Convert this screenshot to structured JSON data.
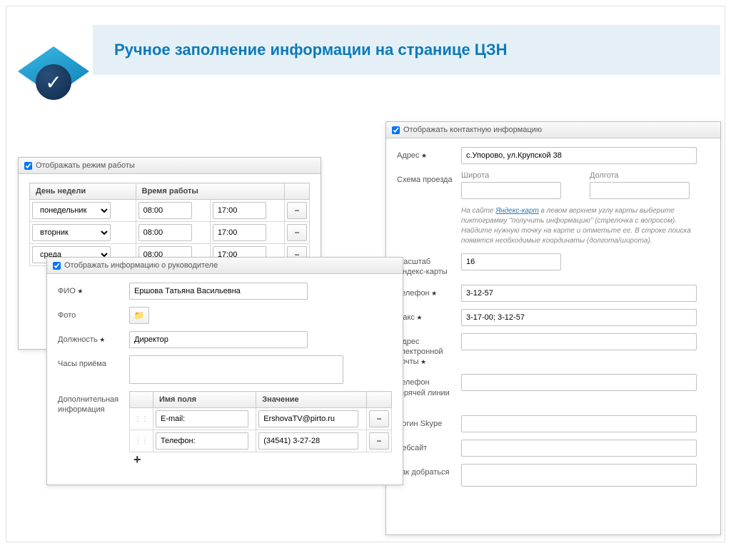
{
  "title": "Ручное заполнение информации на странице ЦЗН",
  "panels": {
    "schedule": {
      "checkbox_label": "Отображать режим работы",
      "col_day": "День недели",
      "col_time": "Время работы",
      "rows": [
        {
          "day": "понедельник",
          "from": "08:00",
          "to": "17:00"
        },
        {
          "day": "вторник",
          "from": "08:00",
          "to": "17:00"
        },
        {
          "day": "среда",
          "from": "08:00",
          "to": "17:00"
        }
      ]
    },
    "manager": {
      "checkbox_label": "Отображать информацию о руководителе",
      "labels": {
        "fio": "ФИО",
        "photo": "Фото",
        "position": "Должность",
        "hours": "Часы приёма",
        "extra": "Дополнительная информация"
      },
      "values": {
        "fio": "Ершова Татьяна Васильевна",
        "position": "Директор",
        "hours": ""
      },
      "extra_table": {
        "col_name": "Имя поля",
        "col_value": "Значение",
        "rows": [
          {
            "name": "E-mail:",
            "value": "ErshovaTV@pirto.ru"
          },
          {
            "name": "Телефон:",
            "value": "(34541) 3-27-28"
          }
        ]
      }
    },
    "contact": {
      "checkbox_label": "Отображать контактную информацию",
      "labels": {
        "address": "Адрес",
        "route": "Схема проезда",
        "lat": "Широта",
        "lon": "Долгота",
        "zoom": "Масштаб Яндекс-карты",
        "phone": "Телефон",
        "fax": "Факс",
        "email": "Адрес электронной почты",
        "hotline": "Телефон горячей линии",
        "skype": "Логин Skype",
        "website": "Вебсайт",
        "directions": "Как добраться"
      },
      "values": {
        "address": "с.Упорово, ул.Крупской 38",
        "lat": "",
        "lon": "",
        "zoom": "16",
        "phone": "3-12-57",
        "fax": "3-17-00; 3-12-57",
        "email": "",
        "hotline": "",
        "skype": "",
        "website": "",
        "directions": ""
      },
      "hint_pre": "На сайте ",
      "hint_link": "Яндекс-карт",
      "hint_post": " в левом верхнем углу карты выберите пиктограмму \"получить информацию\" (стрелочка с вопросом). Найдите нужную точку на карте и отметьте ее. В строке поиска появятся необходимые координаты (долгота/широта)."
    }
  }
}
